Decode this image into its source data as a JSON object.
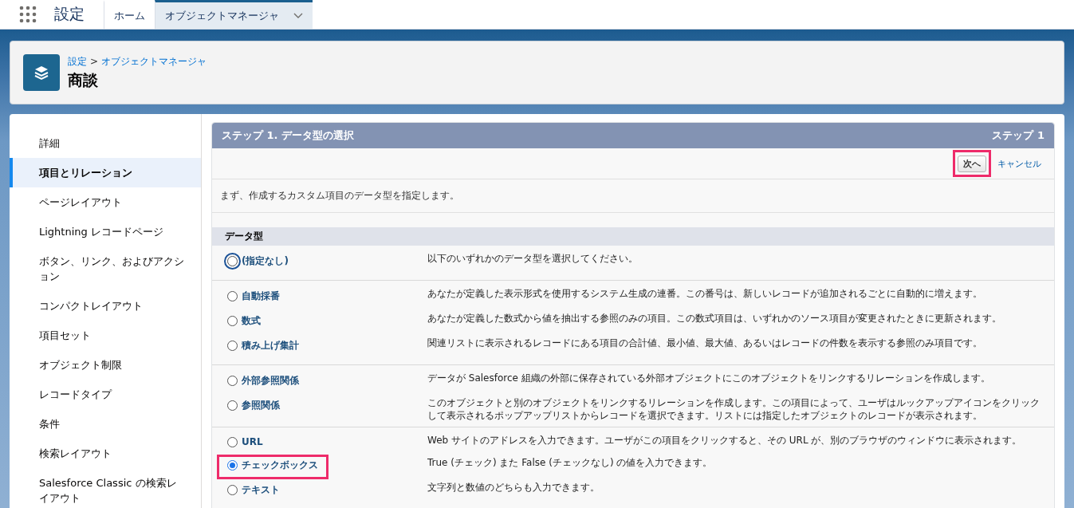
{
  "app_bar": {
    "app_name": "設定",
    "tabs": [
      {
        "label": "ホーム",
        "selected": false
      },
      {
        "label": "オブジェクトマネージャ",
        "selected": true
      }
    ]
  },
  "header": {
    "breadcrumb": [
      {
        "label": "設定"
      },
      {
        "label": "オブジェクトマネージャ"
      }
    ],
    "separator": ">",
    "title": "商談"
  },
  "sidebar": {
    "items": [
      {
        "label": "詳細",
        "selected": false
      },
      {
        "label": "項目とリレーション",
        "selected": true
      },
      {
        "label": "ページレイアウト",
        "selected": false
      },
      {
        "label": "Lightning レコードページ",
        "selected": false
      },
      {
        "label": "ボタン、リンク、およびアクション",
        "selected": false
      },
      {
        "label": "コンパクトレイアウト",
        "selected": false
      },
      {
        "label": "項目セット",
        "selected": false
      },
      {
        "label": "オブジェクト制限",
        "selected": false
      },
      {
        "label": "レコードタイプ",
        "selected": false
      },
      {
        "label": "条件",
        "selected": false
      },
      {
        "label": "検索レイアウト",
        "selected": false
      },
      {
        "label": "Salesforce Classic の検索レイアウト",
        "selected": false
      }
    ]
  },
  "step": {
    "title": "ステップ 1. データ型の選択",
    "step_label": "ステップ 1",
    "next_button": {
      "label": "次へ",
      "highlighted": true
    },
    "cancel_link": "キャンセル",
    "intro": "まず、作成するカスタム項目のデータ型を指定します。",
    "section_title": "データ型",
    "groups": [
      [
        {
          "label": "(指定なし)",
          "description": "以下のいずれかのデータ型を選択してください。",
          "selected": false,
          "focused": true,
          "highlighted": false
        }
      ],
      [
        {
          "label": "自動採番",
          "description": "あなたが定義した表示形式を使用するシステム生成の連番。この番号は、新しいレコードが追加されるごとに自動的に増えます。",
          "selected": false,
          "focused": false,
          "highlighted": false
        },
        {
          "label": "数式",
          "description": "あなたが定義した数式から値を抽出する参照のみの項目。この数式項目は、いずれかのソース項目が変更されたときに更新されます。",
          "selected": false,
          "focused": false,
          "highlighted": false
        },
        {
          "label": "積み上げ集計",
          "description": "関連リストに表示されるレコードにある項目の合計値、最小値、最大値、あるいはレコードの件数を表示する参照のみ項目です。",
          "selected": false,
          "focused": false,
          "highlighted": false
        }
      ],
      [
        {
          "label": "外部参照関係",
          "description": "データが Salesforce 組織の外部に保存されている外部オブジェクトにこのオブジェクトをリンクするリレーションを作成します。",
          "selected": false,
          "focused": false,
          "highlighted": false
        },
        {
          "label": "参照関係",
          "description": "このオブジェクトと別のオブジェクトをリンクするリレーションを作成します。この項目によって、ユーザはルックアップアイコンをクリックして表示されるポップアップリストからレコードを選択できます。リストには指定したオブジェクトのレコードが表示されます。",
          "selected": false,
          "focused": false,
          "highlighted": false
        }
      ],
      [
        {
          "label": "URL",
          "description": "Web サイトのアドレスを入力できます。ユーザがこの項目をクリックすると、その URL が、別のブラウザのウィンドウに表示されます。",
          "selected": false,
          "focused": false,
          "highlighted": false
        },
        {
          "label": "チェックボックス",
          "description": "True (チェック) また False (チェックなし) の値を入力できます。",
          "selected": true,
          "focused": false,
          "highlighted": true
        },
        {
          "label": "テキスト",
          "description": "文字列と数値のどちらも入力できます。",
          "selected": false,
          "focused": false,
          "highlighted": false
        }
      ]
    ]
  }
}
